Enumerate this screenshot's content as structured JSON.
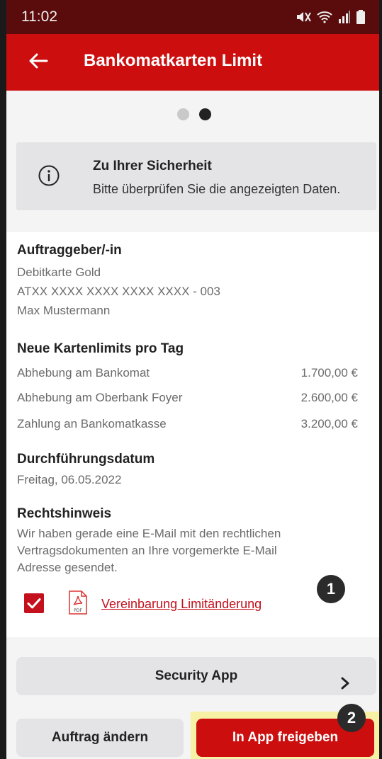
{
  "status_bar": {
    "time": "11:02",
    "icons": [
      "mute-icon",
      "wifi-icon",
      "signal-icon",
      "battery-icon"
    ]
  },
  "app_bar": {
    "title": "Bankomatkarten Limit",
    "back_icon": "arrow-left-icon"
  },
  "pager": {
    "total": 2,
    "active": 2
  },
  "security_notice": {
    "icon": "info-circle-icon",
    "heading": "Zu Ihrer Sicherheit",
    "text": "Bitte überprüfen Sie die angezeigten Daten."
  },
  "orderer": {
    "heading": "Auftraggeber/-in",
    "card": "Debitkarte Gold",
    "account": "ATXX XXXX XXXX XXXX XXXX - 003",
    "name": "Max Mustermann"
  },
  "limits": {
    "heading": "Neue Kartenlimits pro Tag",
    "rows": [
      {
        "label": "Abhebung am Bankomat",
        "amount": "1.700,00 €"
      },
      {
        "label": "Abhebung am Oberbank Foyer",
        "amount": "2.600,00 €"
      },
      {
        "label": "Zahlung an Bankomatkasse",
        "amount": "3.200,00 €"
      }
    ]
  },
  "execution": {
    "heading": "Durchführungsdatum",
    "date": "Freitag, 06.05.2022"
  },
  "legal": {
    "heading": "Rechtshinweis",
    "lines": [
      "Wir haben gerade eine E-Mail mit den rechtlichen",
      "Vertragsdokumenten an Ihre vorgemerkte E-Mail",
      "Adresse gesendet."
    ],
    "checkbox_checked": true,
    "document_link": "Vereinbarung Limitänderung",
    "document_icon": "pdf-file-icon"
  },
  "badges": {
    "one": "1",
    "two": "2"
  },
  "buttons": {
    "security_app": "Security App",
    "change_order": "Auftrag ändern",
    "approve_in_app": "In App freigeben"
  },
  "colors": {
    "brand_red": "#cc0e0e",
    "status_bar": "#5a0b0b",
    "highlight": "#f7f1a6"
  }
}
